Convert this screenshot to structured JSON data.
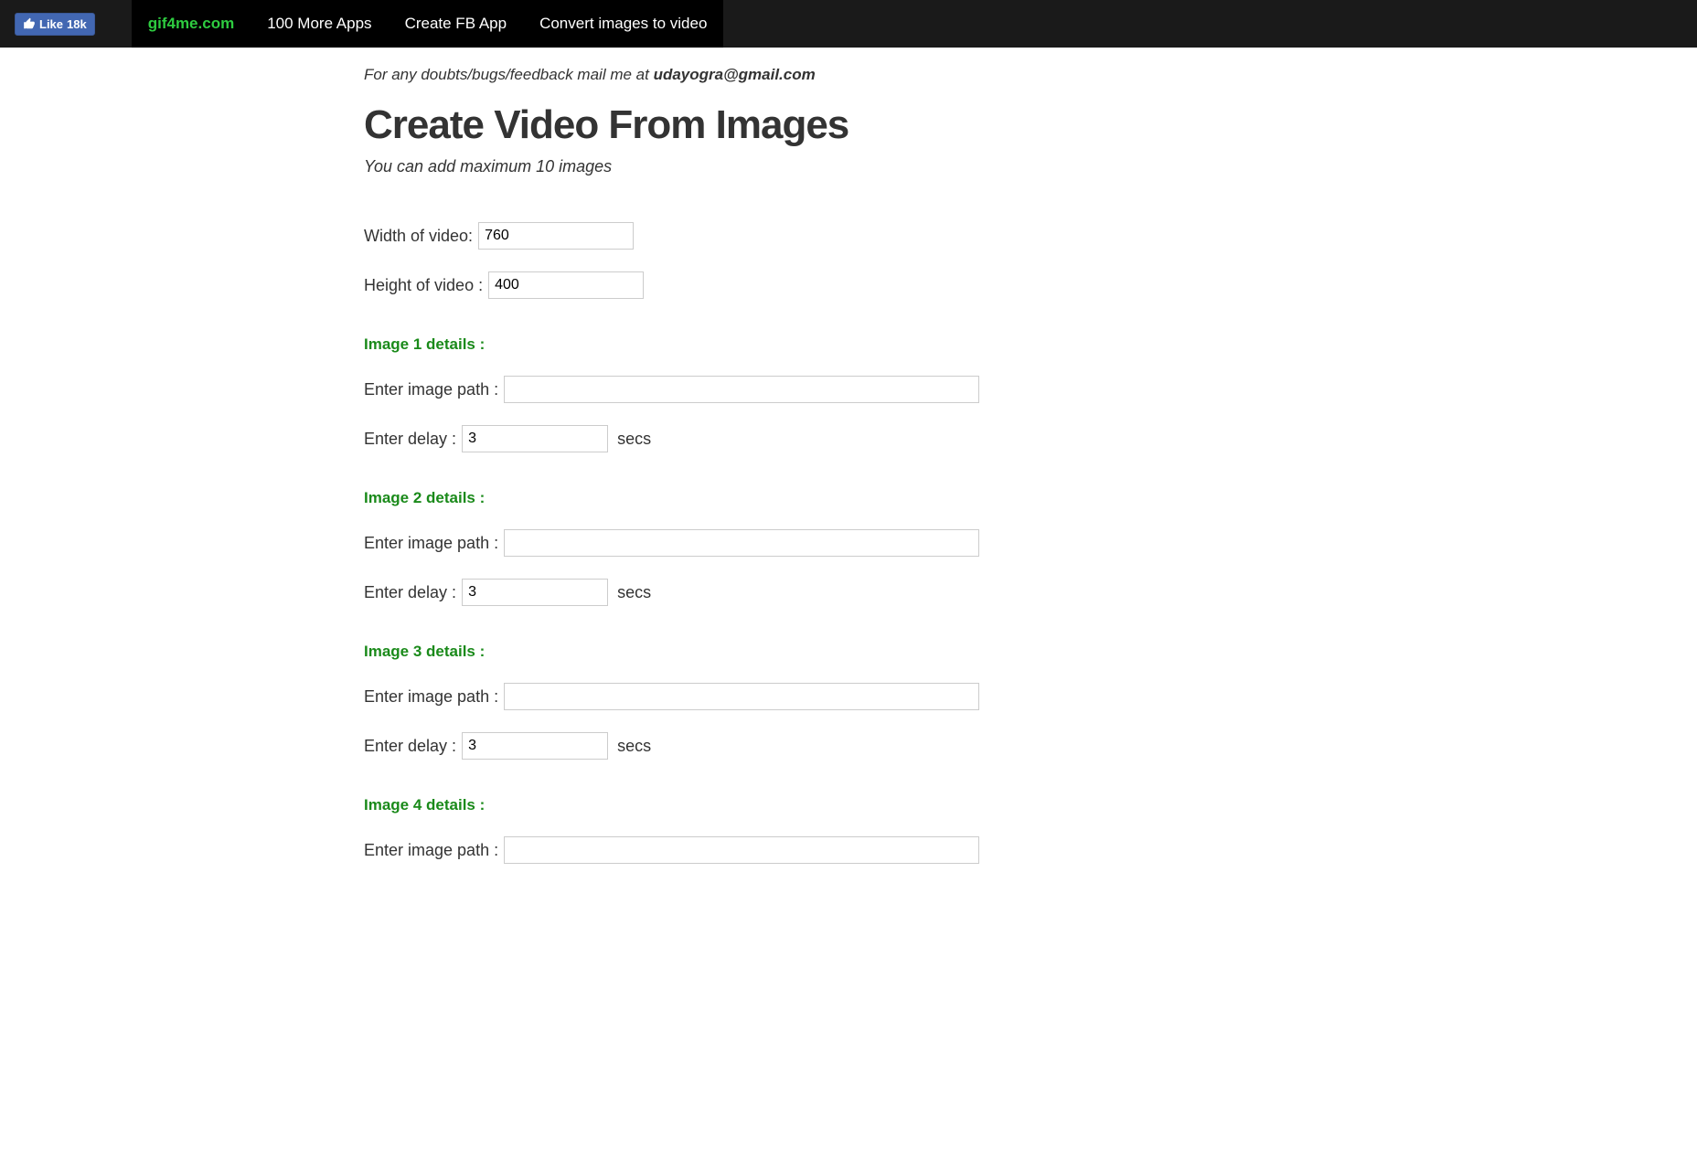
{
  "topbar": {
    "fb_like_text": "Like",
    "fb_like_count": "18k",
    "nav": [
      {
        "label": "gif4me.com",
        "brand": true
      },
      {
        "label": "100 More Apps",
        "brand": false
      },
      {
        "label": "Create FB App",
        "brand": false
      },
      {
        "label": "Convert images to video",
        "brand": false
      }
    ]
  },
  "feedback_prefix": "For any doubts/bugs/feedback mail me at ",
  "feedback_email": "udayogra@gmail.com",
  "heading": "Create Video From Images",
  "subtitle": "You can add maximum 10 images",
  "width_label": "Width of video:",
  "width_value": "760",
  "height_label": "Height of video :",
  "height_value": "400",
  "path_label": "Enter image path :",
  "delay_label": "Enter delay :",
  "delay_suffix": "secs",
  "images": [
    {
      "heading": "Image 1 details :",
      "path": "",
      "delay": "3"
    },
    {
      "heading": "Image 2 details :",
      "path": "",
      "delay": "3"
    },
    {
      "heading": "Image 3 details :",
      "path": "",
      "delay": "3"
    },
    {
      "heading": "Image 4 details :",
      "path": "",
      "delay": ""
    }
  ]
}
